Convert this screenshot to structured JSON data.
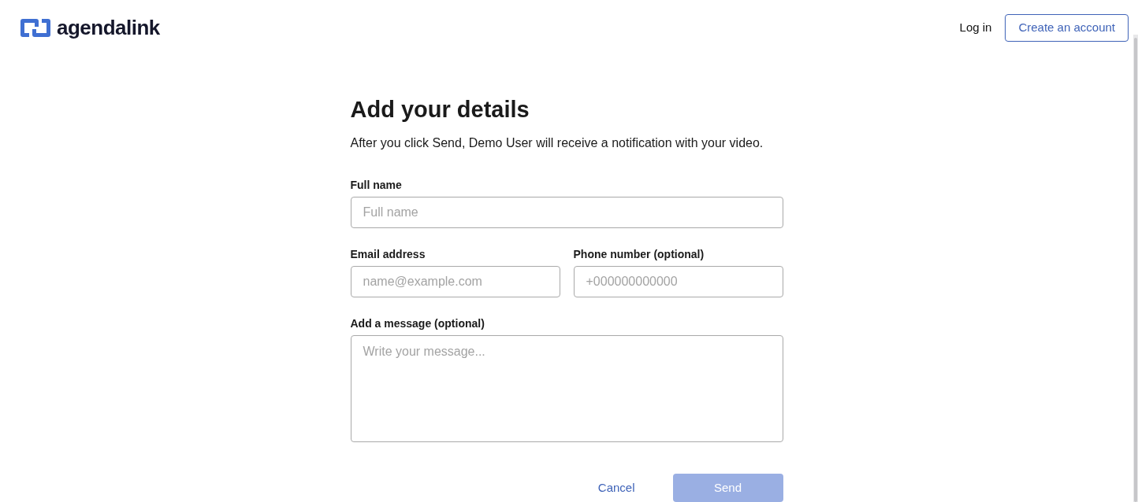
{
  "header": {
    "logo": "agendalink",
    "login": "Log in",
    "create_account": "Create an account"
  },
  "form": {
    "title": "Add your details",
    "subtitle": "After you click Send, Demo User will receive a notification with your video.",
    "rows": [
      [
        {
          "kind": "text",
          "label": "Full name",
          "placeholder": "Full name"
        }
      ],
      [
        {
          "kind": "text",
          "label": "Email address",
          "placeholder": "name@example.com"
        },
        {
          "kind": "text",
          "label": "Phone number (optional)",
          "placeholder": "+000000000000"
        }
      ],
      [
        {
          "kind": "textarea",
          "label": "Add a message (optional)",
          "placeholder": "Write your message..."
        }
      ]
    ],
    "cancel": "Cancel",
    "send": {
      "label": "Send",
      "disabled": true
    }
  }
}
